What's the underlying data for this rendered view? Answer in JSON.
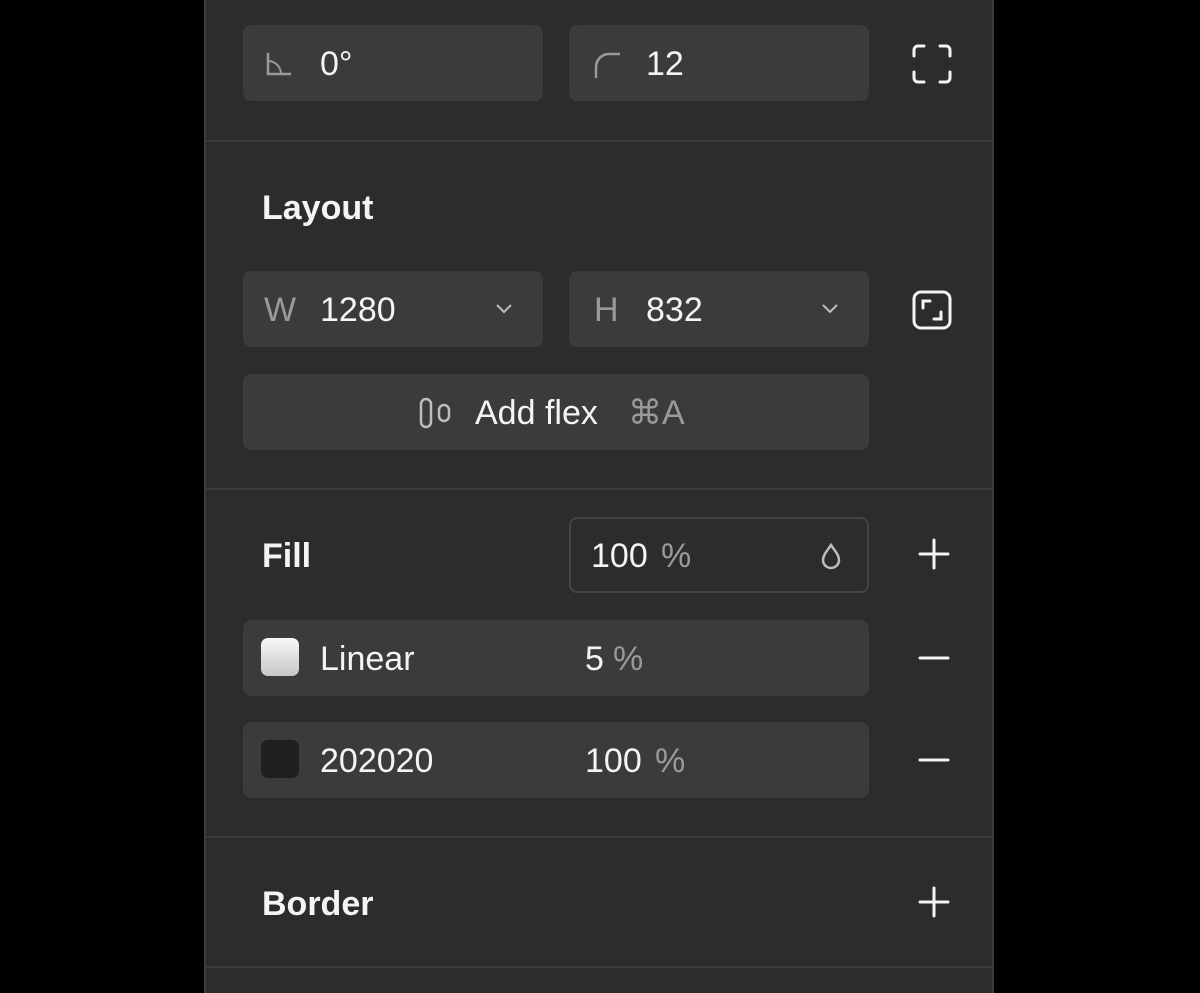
{
  "transform": {
    "rotation_value": "0°",
    "radius_value": "12"
  },
  "layout": {
    "title": "Layout",
    "width_prefix": "W",
    "width_value": "1280",
    "height_prefix": "H",
    "height_value": "832",
    "add_flex_label": "Add flex",
    "add_flex_shortcut": "⌘A"
  },
  "fill": {
    "title": "Fill",
    "opacity_value": "100",
    "opacity_unit": "%",
    "layers": [
      {
        "name": "Linear",
        "opacity": "5",
        "unit": "%"
      },
      {
        "name": "202020",
        "opacity": "100",
        "unit": "%",
        "swatch": "#202020"
      }
    ]
  },
  "border": {
    "title": "Border"
  },
  "colors": {
    "background": "#000000",
    "panel": "#2c2c2c",
    "field": "#3b3b3b",
    "text": "#f4f4f4",
    "muted_text": "#9a9a9a"
  },
  "icons": [
    "rotation-icon",
    "corner-radius-icon",
    "independent-corners-icon",
    "chevron-down-icon",
    "resize-to-fit-icon",
    "flex-layout-icon",
    "opacity-drop-icon",
    "plus-icon",
    "minus-icon"
  ]
}
